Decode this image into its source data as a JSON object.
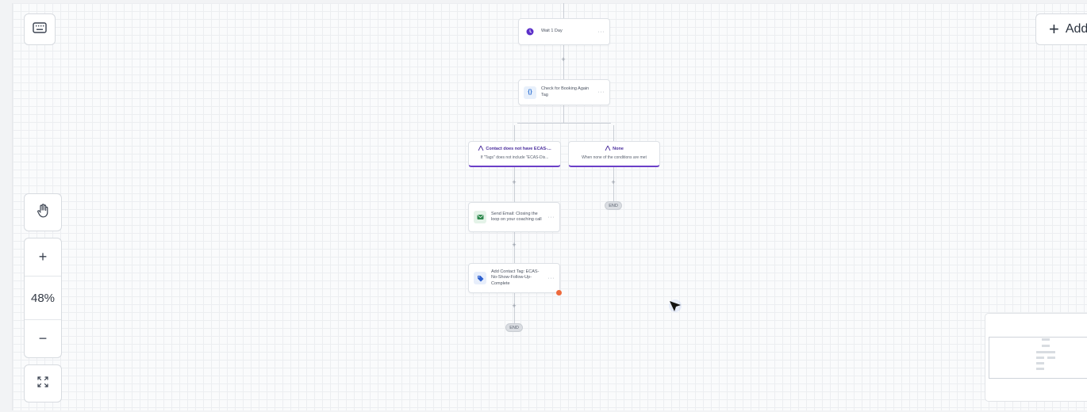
{
  "zoom": {
    "level": "48%",
    "zoom_in": "+",
    "zoom_out": "−"
  },
  "toolbar": {
    "add_label": "Add"
  },
  "workflow": {
    "nodes": [
      {
        "id": "wait",
        "label": "Wait 1 Day",
        "icon": "clock-icon",
        "color": "#5b2fc9"
      },
      {
        "id": "check",
        "label": "Check for Booking Again Tag",
        "icon": "code-braces-icon",
        "color": "#2c6fd1"
      },
      {
        "id": "email",
        "label": "Send Email: Closing the loop on your coaching call",
        "icon": "email-icon",
        "color": "#2e8a4e"
      },
      {
        "id": "tag",
        "label": "Add Contact Tag: ECAS-No-Show-Follow-Up-Complete",
        "icon": "tag-icon",
        "color": "#2c5fcf"
      }
    ],
    "branches": [
      {
        "title": "Contact does not have ECAS-...",
        "subtitle": "If \"Tags\" does not include \"ECAS-Dis..."
      },
      {
        "title": "None",
        "subtitle": "When none of the conditions are met"
      }
    ],
    "end_label": "END",
    "add_step": "+",
    "more": "···"
  },
  "colors": {
    "branch_accent": "#6b3fc8",
    "error_dot": "#ee6a3c"
  }
}
